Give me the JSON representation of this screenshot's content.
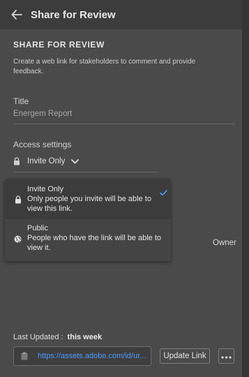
{
  "header": {
    "title": "Share for Review"
  },
  "section": {
    "heading": "SHARE FOR REVIEW",
    "description": "Create a web link for stakeholders to comment and provide feedback."
  },
  "title_field": {
    "label": "Title",
    "value": "Energem Report"
  },
  "access": {
    "label": "Access settings",
    "selected": "Invite Only",
    "options": [
      {
        "title": "Invite Only",
        "description": "Only people you invite will be able to view this link.",
        "icon": "lock-icon",
        "checked": true
      },
      {
        "title": "Public",
        "description": "People who have the link will be able to view it.",
        "icon": "globe-icon",
        "checked": false
      }
    ]
  },
  "owner_label": "Owner",
  "footer": {
    "last_updated_label": "Last Updated :",
    "last_updated_value": "this week",
    "link_url": "https://assets.adobe.com/id/ur...",
    "update_button": "Update Link",
    "more_button": "more-options"
  },
  "colors": {
    "accent": "#4c9bff",
    "panel": "#4a4a4a",
    "menu": "#3c3c3c"
  }
}
